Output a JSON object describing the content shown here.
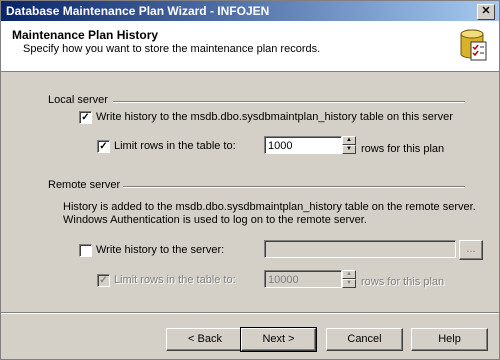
{
  "window": {
    "title": "Database Maintenance Plan Wizard - INFOJEN",
    "close_glyph": "✕"
  },
  "header": {
    "title": "Maintenance Plan History",
    "subtitle": "Specify how you want to store the maintenance plan records.",
    "icon": "database-checklist-icon"
  },
  "local": {
    "group_label": "Local server",
    "write_history": {
      "checked": true,
      "label": "Write history to the msdb.dbo.sysdbmaintplan_history table on this server"
    },
    "limit_rows": {
      "checked": true,
      "label": "Limit rows in the table to:",
      "value": "1000",
      "suffix": "rows for this plan"
    }
  },
  "remote": {
    "group_label": "Remote server",
    "description_line1": "History is added to the msdb.dbo.sysdbmaintplan_history table on the remote server.",
    "description_line2": "Windows Authentication is used to log on to the remote server.",
    "write_history": {
      "checked": false,
      "label": "Write history to the server:",
      "value": ""
    },
    "browse_label": "...",
    "limit_rows": {
      "checked": true,
      "label": "Limit rows in the table to:",
      "value": "10000",
      "suffix": "rows for this plan"
    }
  },
  "buttons": {
    "back": "< Back",
    "next": "Next >",
    "cancel": "Cancel",
    "help": "Help"
  },
  "check_glyph": "✓"
}
